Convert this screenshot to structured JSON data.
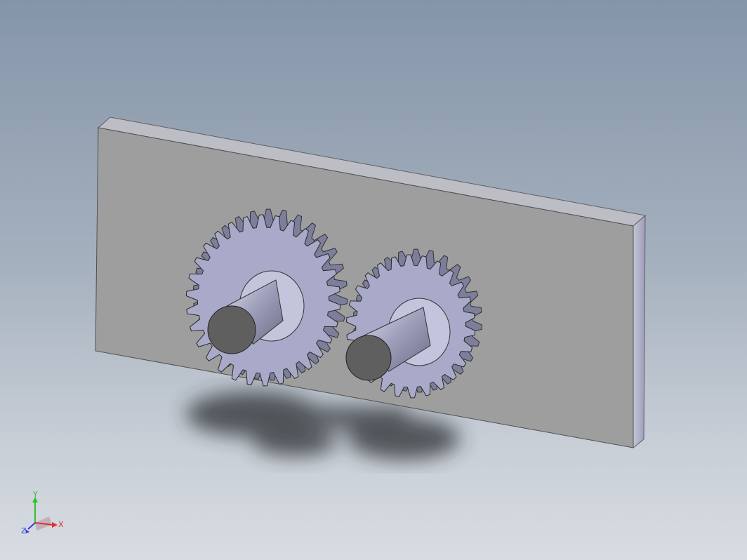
{
  "viewport": {
    "background_top": "#8595a9",
    "background_bottom": "#d8dce2"
  },
  "model": {
    "plate_face_color": "#9d9d9d",
    "plate_edge_color": "#b2b2c4",
    "gear_color": "#a9a9c9",
    "shaft_color": "#8b8fa8",
    "gear_count": 2
  },
  "triad": {
    "x_label": "X",
    "y_label": "Y",
    "z_label": "Z",
    "x_color": "#e03030",
    "y_color": "#30c030",
    "z_color": "#3040e0"
  }
}
